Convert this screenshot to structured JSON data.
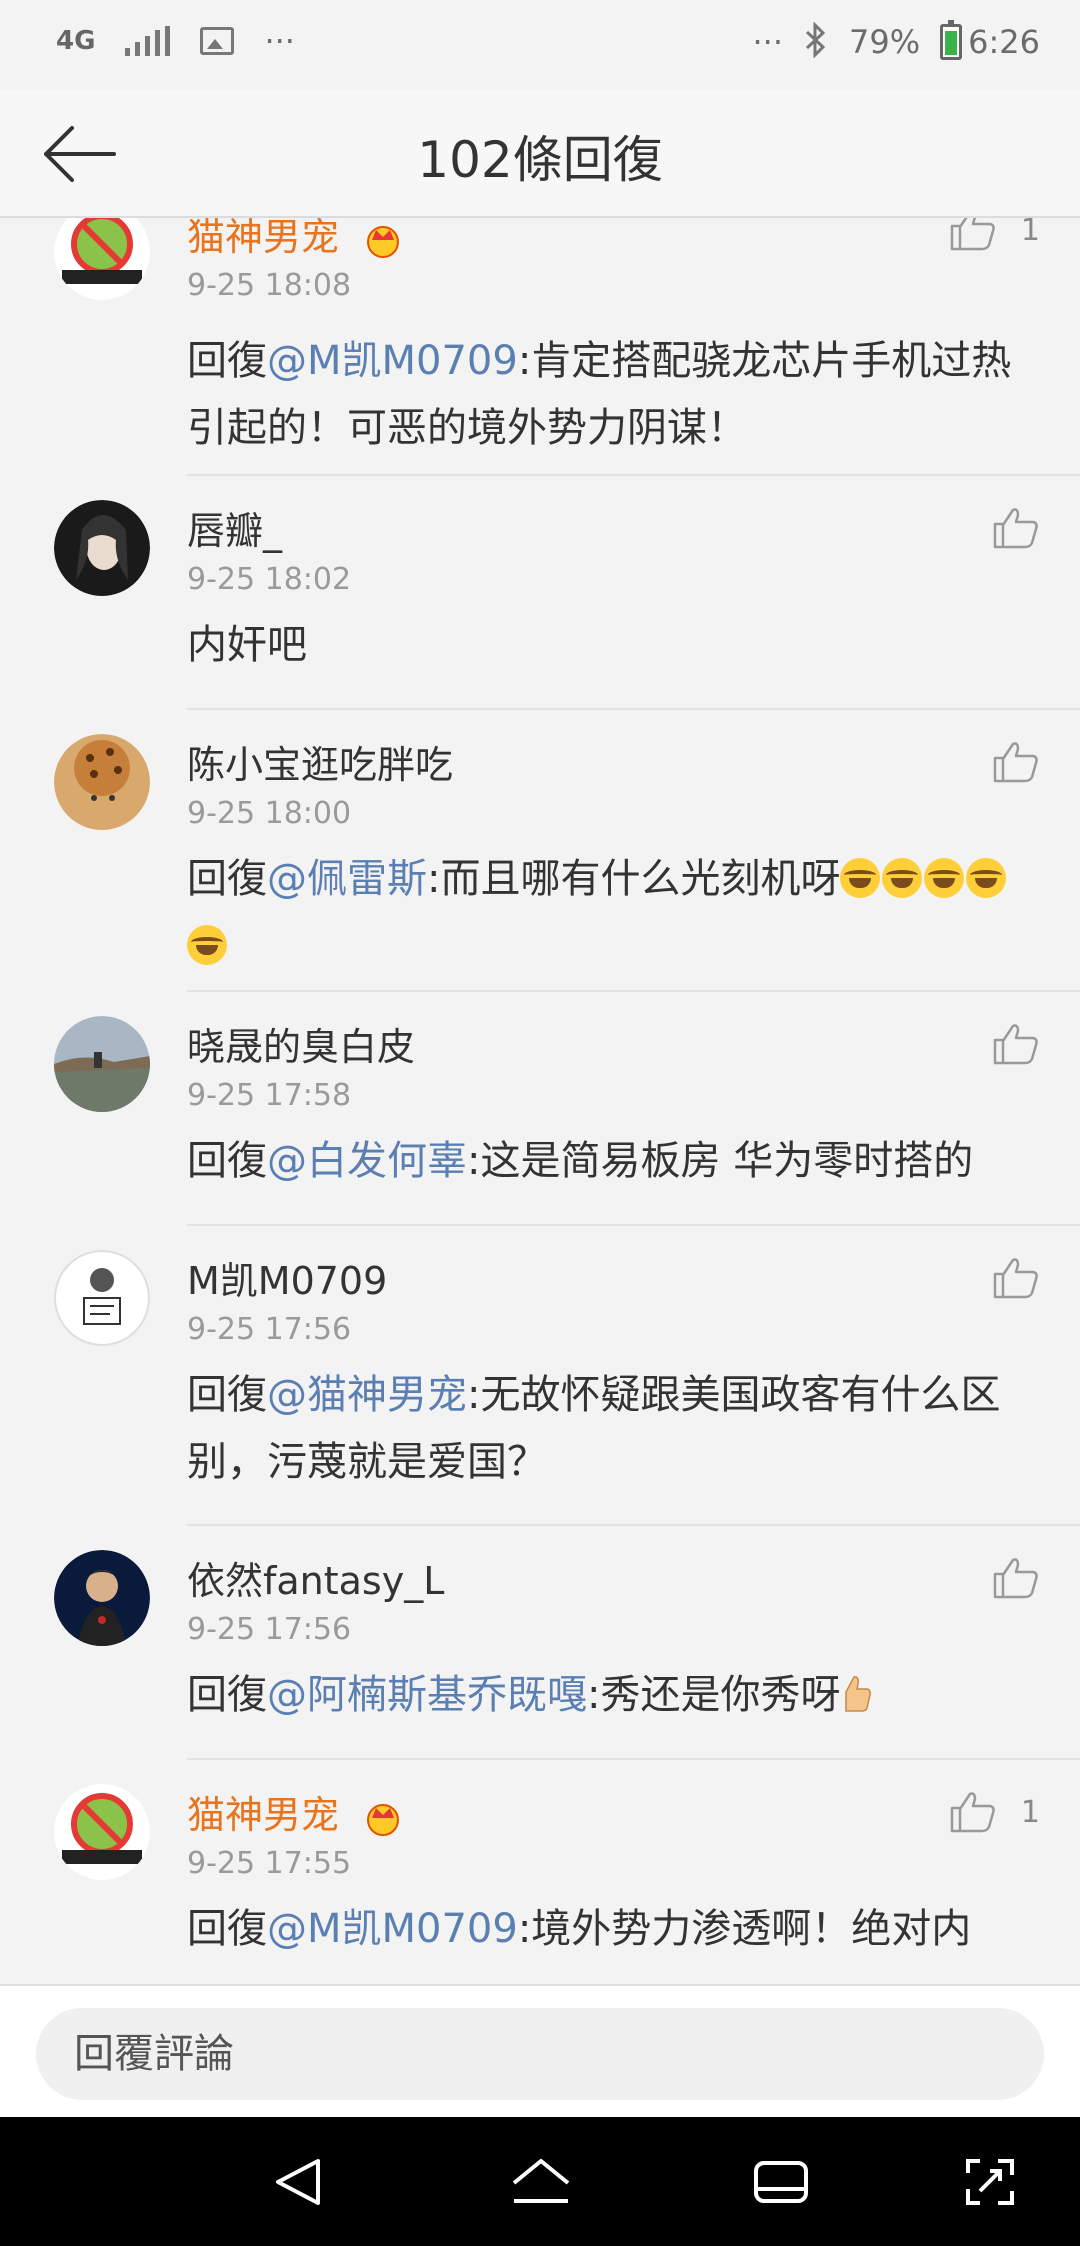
{
  "status_bar": {
    "network": "4G",
    "more": "···",
    "more_right": "···",
    "battery_text": "79%",
    "battery_level": 0.79,
    "time": "6:26",
    "icons": [
      "signal-icon",
      "image-icon",
      "bluetooth-icon",
      "battery-icon"
    ]
  },
  "header": {
    "title": "102條回復",
    "back_icon": "arrow-left-icon"
  },
  "colors": {
    "vip_name": "#e8741e",
    "mention": "#5b7fb3",
    "background": "#f3f3f3"
  },
  "comments": [
    {
      "name": "猫神男宠",
      "vip": true,
      "time": "9-25 18:08",
      "likes": "1",
      "prefix": "回復",
      "mention": "@M凯M0709",
      "text": ":肯定搭配骁龙芯片手机过热引起的！可恶的境外势力阴谋！"
    },
    {
      "name": "唇瓣_",
      "vip": false,
      "time": "9-25 18:02",
      "likes": "",
      "text": "内奸吧"
    },
    {
      "name": "陈小宝逛吃胖吃",
      "vip": false,
      "time": "9-25 18:00",
      "likes": "",
      "prefix": "回復",
      "mention": "@佩雷斯",
      "text": ":而且哪有什么光刻机呀"
    },
    {
      "name": "晓晟的臭白皮",
      "vip": false,
      "time": "9-25 17:58",
      "likes": "",
      "prefix": "回復",
      "mention": "@白发何辜",
      "text": ":这是简易板房  华为零时搭的"
    },
    {
      "name": "M凯M0709",
      "vip": false,
      "time": "9-25 17:56",
      "likes": "",
      "prefix": "回復",
      "mention": "@猫神男宠",
      "text": ":无故怀疑跟美国政客有什么区别，污蔑就是爱国？"
    },
    {
      "name": "依然fantasy_L",
      "vip": false,
      "time": "9-25 17:56",
      "likes": "",
      "prefix": "回復",
      "mention": "@阿楠斯基乔既嘎",
      "text": ":秀还是你秀呀"
    },
    {
      "name": "猫神男宠",
      "vip": true,
      "time": "9-25 17:55",
      "likes": "1",
      "prefix": "回復",
      "mention": "@M凯M0709",
      "text": ":境外势力渗透啊！绝对内"
    }
  ],
  "reply_bar": {
    "placeholder": "回覆評論"
  },
  "nav_bar": {
    "icons": [
      "back-triangle-icon",
      "home-icon",
      "recents-icon",
      "screenshot-icon"
    ]
  }
}
